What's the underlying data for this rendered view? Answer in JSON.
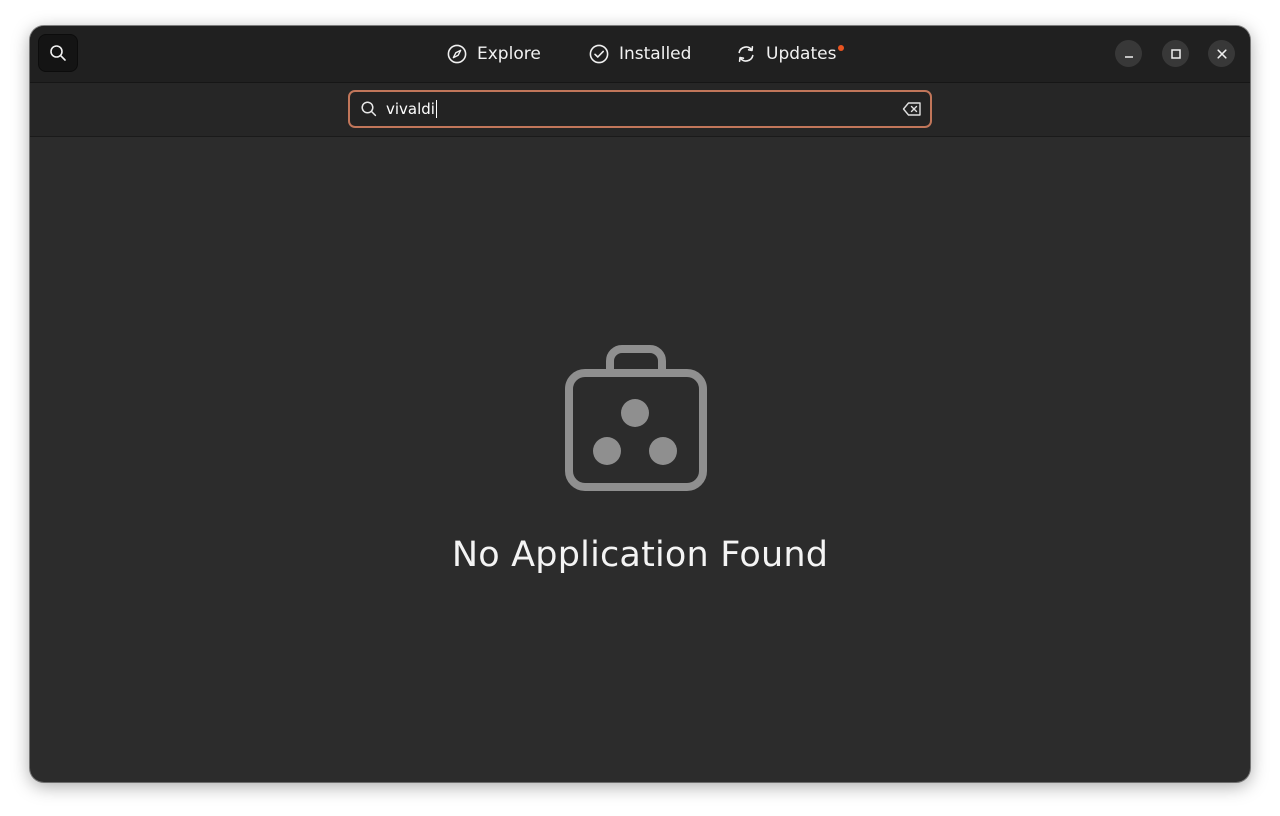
{
  "header": {
    "tabs": [
      {
        "label": "Explore",
        "icon": "compass-icon"
      },
      {
        "label": "Installed",
        "icon": "check-circle-icon"
      },
      {
        "label": "Updates",
        "icon": "refresh-icon",
        "has_notification": true
      }
    ],
    "window_controls": [
      "minimize-icon",
      "maximize-icon",
      "close-icon"
    ]
  },
  "search": {
    "value": "vivaldi",
    "clear_icon": "backspace-icon"
  },
  "empty_state": {
    "icon": "shopping-bag-icon",
    "message": "No Application Found"
  },
  "colors": {
    "accent": "#e95420",
    "entry_border": "#c1765a",
    "background": "#2c2c2c",
    "header": "#202020",
    "icon_gray": "#8f8f8f"
  }
}
